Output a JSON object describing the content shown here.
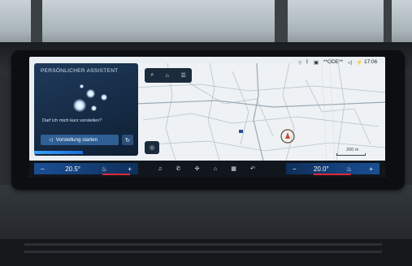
{
  "status_bar": {
    "network": "**ODE**",
    "time": "17:06"
  },
  "assistant": {
    "title": "PERSÖNLICHER ASSISTENT",
    "question": "Darf ich mich kurz vorstellen?",
    "start_button": "Vorstellung starten"
  },
  "map": {
    "scale_label": "200 m"
  },
  "climate": {
    "left_temp": "20.5°",
    "right_temp": "20.0°",
    "minus": "−",
    "plus": "+"
  },
  "colors": {
    "accent_blue": "#1d6fd6",
    "climate_red": "#e0283a"
  },
  "icons": {
    "dock": [
      "music-icon",
      "phone-icon",
      "fan-icon",
      "home-icon",
      "grid-icon",
      "apps-icon"
    ]
  }
}
